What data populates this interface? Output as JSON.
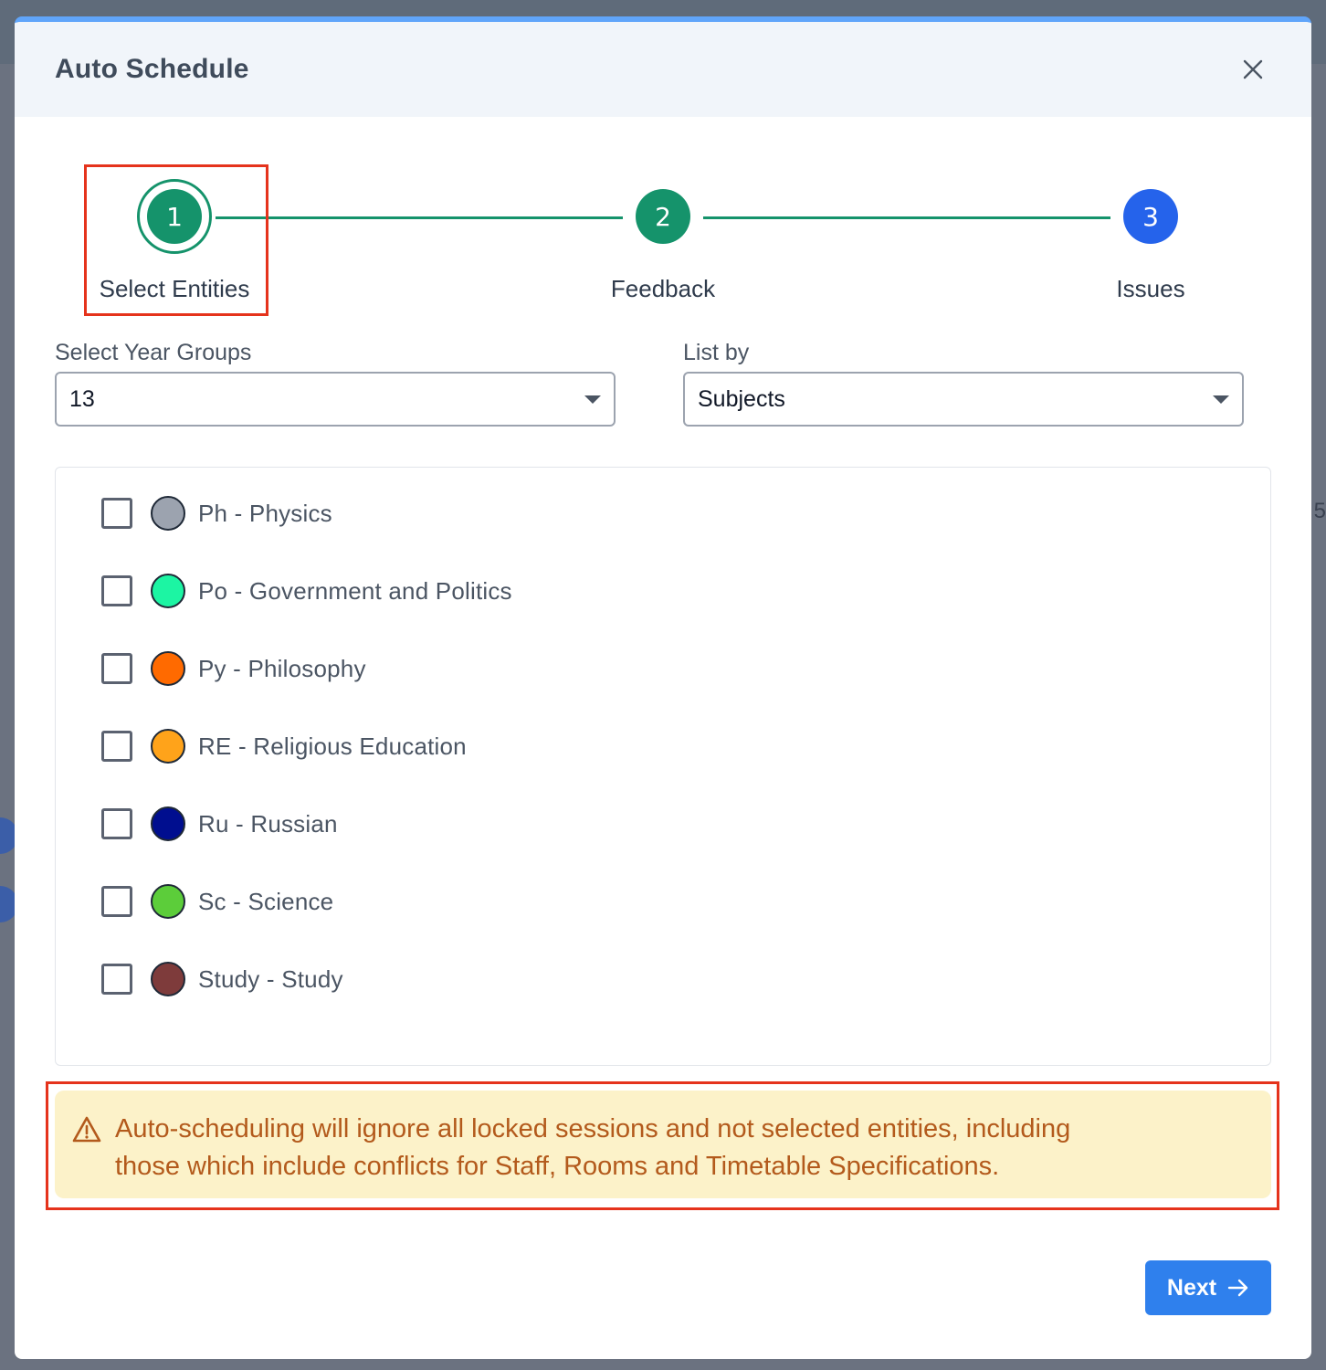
{
  "modal": {
    "title": "Auto Schedule"
  },
  "stepper": {
    "steps": [
      {
        "number": "1",
        "label": "Select Entities",
        "state": "active",
        "color": "#15936b"
      },
      {
        "number": "2",
        "label": "Feedback",
        "state": "complete",
        "color": "#15936b"
      },
      {
        "number": "3",
        "label": "Issues",
        "state": "upcoming",
        "color": "#2563eb"
      }
    ]
  },
  "filters": {
    "year_groups": {
      "label": "Select Year Groups",
      "value": "13"
    },
    "list_by": {
      "label": "List by",
      "value": "Subjects"
    }
  },
  "subjects": [
    {
      "label": "Ph - Physics",
      "color": "#9ca3af",
      "checked": false
    },
    {
      "label": "Po - Government and Politics",
      "color": "#1cf5a3",
      "checked": false
    },
    {
      "label": "Py - Philosophy",
      "color": "#ff6a00",
      "checked": false
    },
    {
      "label": "RE - Religious Education",
      "color": "#ffa31a",
      "checked": false
    },
    {
      "label": "Ru - Russian",
      "color": "#000e8f",
      "checked": false
    },
    {
      "label": "Sc - Science",
      "color": "#5ccd3a",
      "checked": false
    },
    {
      "label": "Study - Study",
      "color": "#7e3b3b",
      "checked": false
    }
  ],
  "alert": {
    "line1": "Auto-scheduling will ignore all locked sessions and not selected entities, including",
    "line2": "those which include conflicts for Staff, Rooms and Timetable Specifications."
  },
  "footer": {
    "next_label": "Next"
  },
  "background": {
    "edge_digit": "5"
  },
  "colors": {
    "accent": "#2f80ed",
    "step_green": "#15936b",
    "highlight_red": "#e5331c",
    "alert_bg": "#fcf2c9",
    "alert_text": "#b35a1c"
  }
}
